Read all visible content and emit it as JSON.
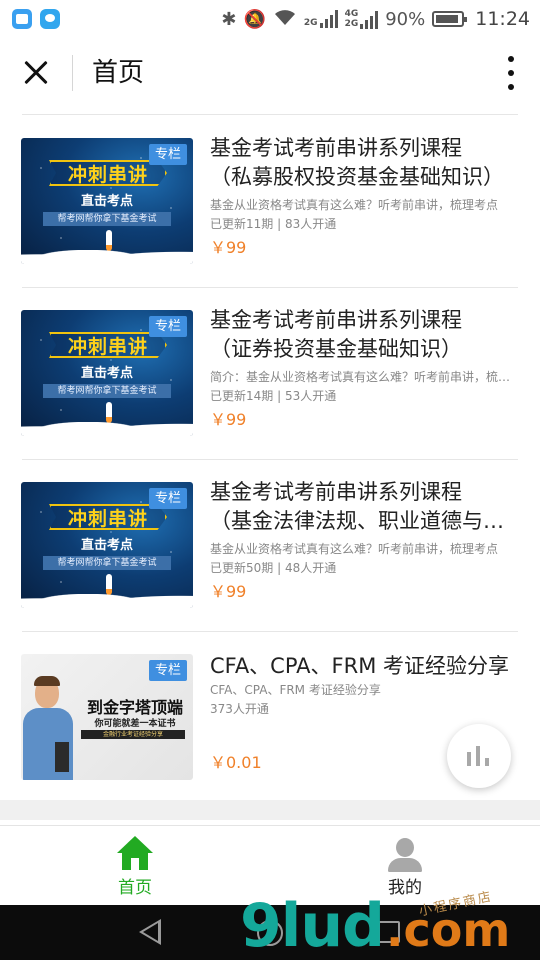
{
  "status_bar": {
    "network_2g": "2G",
    "network_4g": "4G",
    "network_2g_b": "2G",
    "battery_pct": "90%",
    "time": "11:24"
  },
  "header": {
    "title": "首页"
  },
  "courses": [
    {
      "badge": "专栏",
      "thumb_headline": "冲刺串讲",
      "thumb_sub": "直击考点",
      "thumb_strip": "帮考网帮你拿下基金考试",
      "title_line1": "基金考试考前串讲系列课程",
      "title_line2": "（私募股权投资基金基础知识）",
      "desc": "基金从业资格考试真有这么难？听考前串讲，梳理考点",
      "meta": "已更新11期 | 83人开通",
      "price": "￥99"
    },
    {
      "badge": "专栏",
      "thumb_headline": "冲刺串讲",
      "thumb_sub": "直击考点",
      "thumb_strip": "帮考网帮你拿下基金考试",
      "title_line1": "基金考试考前串讲系列课程",
      "title_line2": "（证券投资基金基础知识）",
      "desc": "简介：基金从业资格考试真有这么难？听考前串讲，梳理考点",
      "meta": "已更新14期 | 53人开通",
      "price": "￥99"
    },
    {
      "badge": "专栏",
      "thumb_headline": "冲刺串讲",
      "thumb_sub": "直击考点",
      "thumb_strip": "帮考网帮你拿下基金考试",
      "title_line1": "基金考试考前串讲系列课程",
      "title_line2": "（基金法律法规、职业道德与业务规范）",
      "desc": "基金从业资格考试真有这么难？听考前串讲，梳理考点",
      "meta": "已更新50期 | 48人开通",
      "price": "￥99"
    },
    {
      "badge": "专栏",
      "thumb_headline": "到金字塔顶端",
      "thumb_sub": "你可能就差一本证书",
      "thumb_strip": "金融行业考证经验分享",
      "title_line1": "CFA、CPA、FRM 考证经验分享",
      "title_line2": "",
      "desc": "CFA、CPA、FRM 考证经验分享",
      "meta": "373人开通",
      "price": "￥0.01"
    }
  ],
  "bottom_nav": {
    "home_label": "首页",
    "me_label": "我的"
  },
  "watermark": {
    "main": "9lud",
    "suffix": ".com",
    "small": "小程序商店"
  },
  "colors": {
    "accent_green": "#22aa22",
    "price_orange": "#f0812a",
    "badge_blue": "#3f8fe0"
  },
  "icons": {
    "close": "close-icon",
    "more": "more-vertical-icon",
    "home": "home-icon",
    "user": "user-icon",
    "stats": "bar-chart-icon"
  }
}
